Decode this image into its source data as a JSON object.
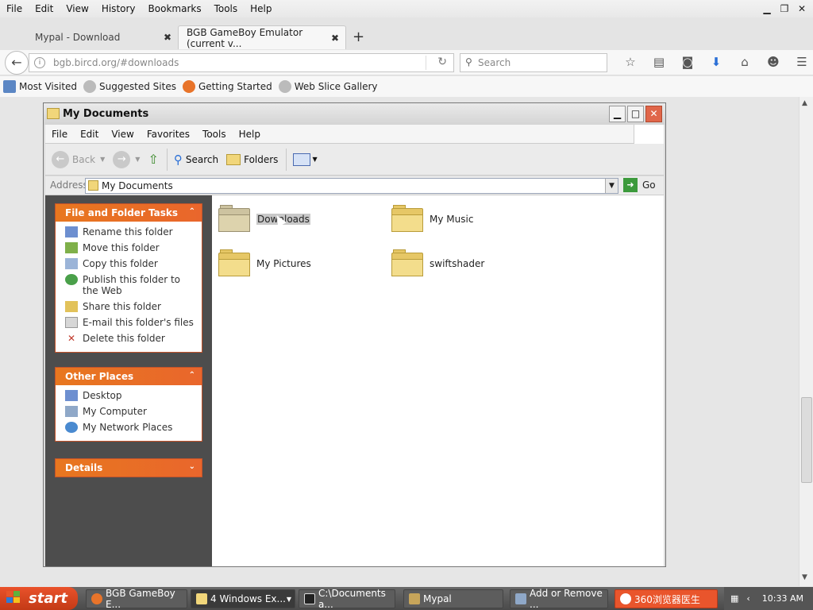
{
  "firefox": {
    "menu": [
      "File",
      "Edit",
      "View",
      "History",
      "Bookmarks",
      "Tools",
      "Help"
    ],
    "tabs": [
      {
        "title": "Mypal - Download"
      },
      {
        "title": "BGB GameBoy Emulator (current v..."
      }
    ],
    "url": "bgb.bircd.org/#downloads",
    "search_placeholder": "Search",
    "bookmarks": [
      "Most Visited",
      "Suggested Sites",
      "Getting Started",
      "Web Slice Gallery"
    ],
    "page_text_fragment": "           "
  },
  "explorer": {
    "title": "My Documents",
    "menu": [
      "File",
      "Edit",
      "View",
      "Favorites",
      "Tools",
      "Help"
    ],
    "toolbar": {
      "back": "Back",
      "search": "Search",
      "folders": "Folders"
    },
    "address_label": "Address",
    "address_value": "My Documents",
    "go_label": "Go",
    "tasks": {
      "title": "File and Folder Tasks",
      "items": [
        "Rename this folder",
        "Move this folder",
        "Copy this folder",
        "Publish this folder to the Web",
        "Share this folder",
        "E-mail this folder's files",
        "Delete this folder"
      ]
    },
    "other_places": {
      "title": "Other Places",
      "items": [
        "Desktop",
        "My Computer",
        "My Network Places"
      ]
    },
    "details": {
      "title": "Details"
    },
    "folders": [
      {
        "name": "Downloads",
        "selected": true
      },
      {
        "name": "My Music"
      },
      {
        "name": "My Pictures"
      },
      {
        "name": "swiftshader"
      }
    ]
  },
  "taskbar": {
    "start": "start",
    "items": [
      "BGB GameBoy E...",
      "4 Windows Ex...",
      "C:\\Documents a...",
      "Mypal",
      "Add or Remove ...",
      "360浏览器医生"
    ],
    "clock": "10:33 AM"
  }
}
